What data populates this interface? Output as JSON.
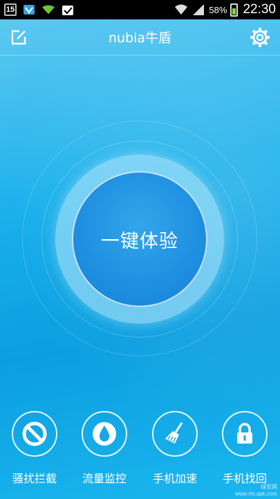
{
  "status_bar": {
    "calendar_day": "15",
    "battery_percent": "58%",
    "battery_level": 0.58,
    "time": "22:30",
    "icons": [
      "calendar-icon",
      "shield-notification-icon",
      "wifi-notification-icon",
      "check-bag-icon",
      "wifi-icon",
      "signal-icon",
      "battery-icon"
    ]
  },
  "header": {
    "title": "nubia牛盾",
    "edit_icon": "edit-icon",
    "settings_icon": "gear-icon"
  },
  "main": {
    "button_label": "一键体验"
  },
  "features": [
    {
      "label": "骚扰拦截",
      "icon": "block-icon"
    },
    {
      "label": "流量监控",
      "icon": "water-drop-icon"
    },
    {
      "label": "手机加速",
      "icon": "broom-icon"
    },
    {
      "label": "手机找回",
      "icon": "lock-icon"
    }
  ],
  "watermark": {
    "line1": "绿安网",
    "line2": "www.rm.apk.com"
  },
  "colors": {
    "status_bar": "#000000",
    "background": "#1aa6e6",
    "main_button": "#1e8fe0",
    "battery_fill": "#7ddc3a"
  }
}
